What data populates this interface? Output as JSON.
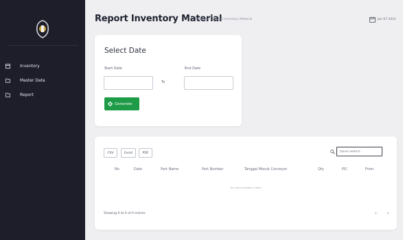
{
  "sidebar": {
    "items": [
      {
        "label": "Inventory",
        "icon": "inventory-icon"
      },
      {
        "label": "Master Data",
        "icon": "folder-icon"
      },
      {
        "label": "Report",
        "icon": "folder-icon"
      }
    ]
  },
  "header": {
    "title": "Report Inventory Material",
    "breadcrumb": "Fatekapp / Report Inventory Material",
    "date": "Jan 07 2021"
  },
  "filter": {
    "heading": "Select Date",
    "start_label": "Start Date",
    "to_label": "To",
    "end_label": "End Date",
    "start_value": "",
    "end_value": "",
    "generate_label": "Generate"
  },
  "table": {
    "export_buttons": [
      "CSV",
      "Excel",
      "PDF"
    ],
    "search_placeholder": "Quick Search",
    "columns": [
      "No",
      "Date",
      "Part Name",
      "Part Number",
      "Tanggal Masuk Conveyor",
      "Qty",
      "PIC",
      "From"
    ],
    "empty_text": "No data available in table",
    "showing_text": "Showing 0 to 0 of 0 entries",
    "prev_label": "‹",
    "next_label": "›"
  },
  "colors": {
    "sidebar_bg": "#1d1e29",
    "page_bg": "#efeff1",
    "generate_btn": "#1e9b47"
  }
}
